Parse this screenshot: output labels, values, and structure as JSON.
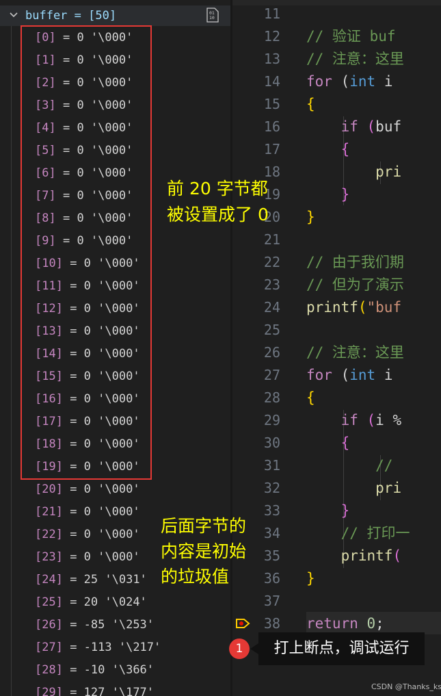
{
  "variables": {
    "header": {
      "expr": "buffer = [50]",
      "icon": "binary-view-icon"
    },
    "rows": [
      {
        "index": "[0]",
        "value": "0 '\\000'"
      },
      {
        "index": "[1]",
        "value": "0 '\\000'"
      },
      {
        "index": "[2]",
        "value": "0 '\\000'"
      },
      {
        "index": "[3]",
        "value": "0 '\\000'"
      },
      {
        "index": "[4]",
        "value": "0 '\\000'"
      },
      {
        "index": "[5]",
        "value": "0 '\\000'"
      },
      {
        "index": "[6]",
        "value": "0 '\\000'"
      },
      {
        "index": "[7]",
        "value": "0 '\\000'"
      },
      {
        "index": "[8]",
        "value": "0 '\\000'"
      },
      {
        "index": "[9]",
        "value": "0 '\\000'"
      },
      {
        "index": "[10]",
        "value": "0 '\\000'"
      },
      {
        "index": "[11]",
        "value": "0 '\\000'"
      },
      {
        "index": "[12]",
        "value": "0 '\\000'"
      },
      {
        "index": "[13]",
        "value": "0 '\\000'"
      },
      {
        "index": "[14]",
        "value": "0 '\\000'"
      },
      {
        "index": "[15]",
        "value": "0 '\\000'"
      },
      {
        "index": "[16]",
        "value": "0 '\\000'"
      },
      {
        "index": "[17]",
        "value": "0 '\\000'"
      },
      {
        "index": "[18]",
        "value": "0 '\\000'"
      },
      {
        "index": "[19]",
        "value": "0 '\\000'"
      },
      {
        "index": "[20]",
        "value": "0 '\\000'"
      },
      {
        "index": "[21]",
        "value": "0 '\\000'"
      },
      {
        "index": "[22]",
        "value": "0 '\\000'"
      },
      {
        "index": "[23]",
        "value": "0 '\\000'"
      },
      {
        "index": "[24]",
        "value": "25 '\\031'"
      },
      {
        "index": "[25]",
        "value": "20 '\\024'"
      },
      {
        "index": "[26]",
        "value": "-85 '\\253'"
      },
      {
        "index": "[27]",
        "value": "-113 '\\217'"
      },
      {
        "index": "[28]",
        "value": "-10 '\\366'"
      },
      {
        "index": "[29]",
        "value": "127 '\\177'"
      }
    ]
  },
  "editor": {
    "line_numbers": [
      "11",
      "12",
      "13",
      "14",
      "15",
      "16",
      "17",
      "18",
      "19",
      "20",
      "21",
      "22",
      "23",
      "24",
      "25",
      "26",
      "27",
      "28",
      "29",
      "30",
      "31",
      "32",
      "33",
      "34",
      "35",
      "36",
      "37",
      "38"
    ],
    "lines": [
      [],
      [
        {
          "t": "// 验证 buf",
          "c": "cm"
        }
      ],
      [
        {
          "t": "// 注意：这里",
          "c": "cm"
        }
      ],
      [
        {
          "t": "for",
          "c": "kw"
        },
        {
          "t": " (",
          "c": ""
        },
        {
          "t": "int",
          "c": "ty"
        },
        {
          "t": " i",
          "c": ""
        }
      ],
      [
        {
          "t": "{",
          "c": "br1"
        }
      ],
      [
        {
          "t": "    ",
          "c": ""
        },
        {
          "t": "if",
          "c": "kw"
        },
        {
          "t": " (",
          "c": "br2"
        },
        {
          "t": "buf",
          "c": ""
        }
      ],
      [
        {
          "t": "    ",
          "c": ""
        },
        {
          "t": "{",
          "c": "br2"
        }
      ],
      [
        {
          "t": "        ",
          "c": ""
        },
        {
          "t": "pri",
          "c": "fn"
        }
      ],
      [
        {
          "t": "    ",
          "c": ""
        },
        {
          "t": "}",
          "c": "br2"
        }
      ],
      [
        {
          "t": "}",
          "c": "br1"
        }
      ],
      [],
      [
        {
          "t": "// 由于我们期",
          "c": "cm"
        }
      ],
      [
        {
          "t": "// 但为了演示",
          "c": "cm"
        }
      ],
      [
        {
          "t": "printf",
          "c": "fn"
        },
        {
          "t": "(",
          "c": "br1"
        },
        {
          "t": "\"buf",
          "c": "str"
        }
      ],
      [],
      [
        {
          "t": "// 注意：这里",
          "c": "cm"
        }
      ],
      [
        {
          "t": "for",
          "c": "kw"
        },
        {
          "t": " (",
          "c": ""
        },
        {
          "t": "int",
          "c": "ty"
        },
        {
          "t": " i",
          "c": ""
        }
      ],
      [
        {
          "t": "{",
          "c": "br1"
        }
      ],
      [
        {
          "t": "    ",
          "c": ""
        },
        {
          "t": "if",
          "c": "kw"
        },
        {
          "t": " (",
          "c": "br2"
        },
        {
          "t": "i ",
          "c": ""
        },
        {
          "t": "%",
          "c": ""
        }
      ],
      [
        {
          "t": "    ",
          "c": ""
        },
        {
          "t": "{",
          "c": "br2"
        }
      ],
      [
        {
          "t": "        ",
          "c": ""
        },
        {
          "t": "//",
          "c": "cm"
        }
      ],
      [
        {
          "t": "        ",
          "c": ""
        },
        {
          "t": "pri",
          "c": "fn"
        }
      ],
      [
        {
          "t": "    ",
          "c": ""
        },
        {
          "t": "}",
          "c": "br2"
        }
      ],
      [
        {
          "t": "    ",
          "c": ""
        },
        {
          "t": "// 打印一",
          "c": "cm"
        }
      ],
      [
        {
          "t": "    ",
          "c": ""
        },
        {
          "t": "printf",
          "c": "fn"
        },
        {
          "t": "(",
          "c": "br2"
        }
      ],
      [
        {
          "t": "}",
          "c": "br1"
        }
      ],
      [],
      [
        {
          "t": "return",
          "c": "kw"
        },
        {
          "t": " ",
          "c": ""
        },
        {
          "t": "0",
          "c": "num"
        },
        {
          "t": ";",
          "c": ""
        }
      ]
    ],
    "breakpoint_icon": "breakpoint-stopped-icon"
  },
  "annotations": {
    "first_bytes_line1": "前 20 字节都",
    "first_bytes_line2": "被设置成了 0",
    "rest_bytes_line1": "后面字节的",
    "rest_bytes_line2": "内容是初始",
    "rest_bytes_line3": "的垃圾值",
    "callout_number": "1",
    "callout_text": "打上断点，调试运行",
    "highlight_color": "#e53935",
    "annotation_color": "#ffff00"
  },
  "watermark": "CSDN @Thanks_ks"
}
